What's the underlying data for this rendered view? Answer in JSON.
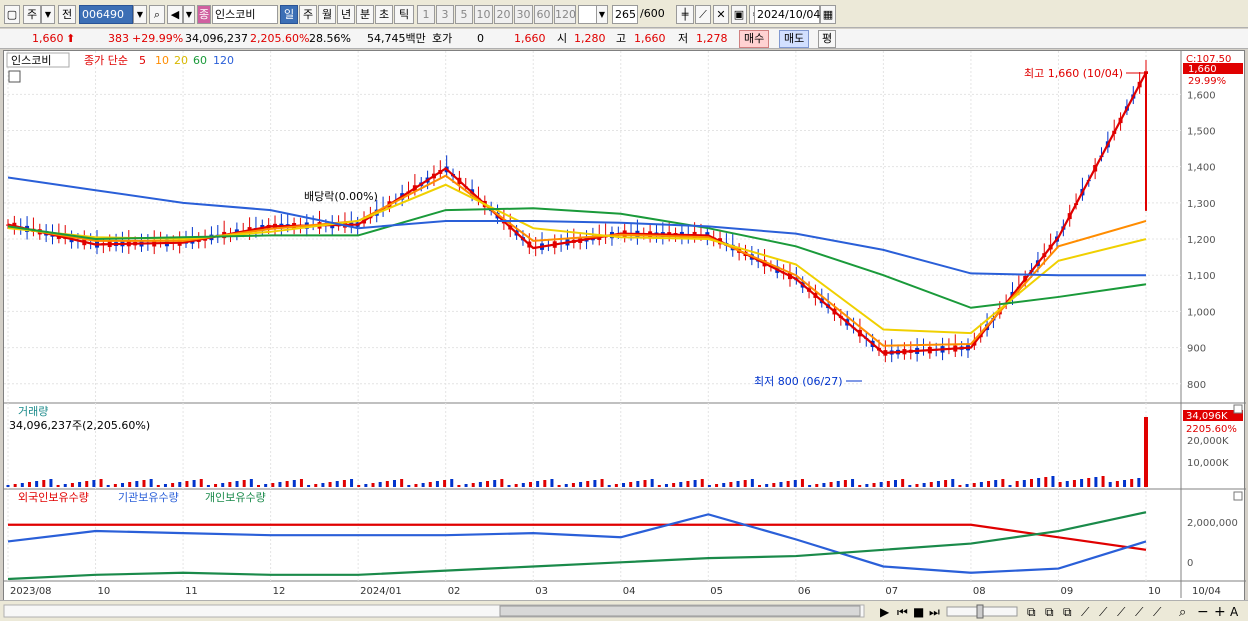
{
  "toolbar": {
    "market": "주",
    "prefix": "전",
    "code": "006490",
    "type_badge": "종",
    "stock_name": "인스코비",
    "periods": [
      "일",
      "주",
      "월",
      "년",
      "분",
      "초",
      "틱"
    ],
    "active_period": "일",
    "intervals": [
      "1",
      "3",
      "5",
      "10",
      "20",
      "30",
      "60",
      "120"
    ],
    "count": "265",
    "count_max": "/600",
    "date": "2024/10/04"
  },
  "quote": {
    "price": "1,660",
    "change": "383",
    "change_pct": "+29.99%",
    "volume": "34,096,237",
    "volume_pct": "2,205.60%",
    "turnover": "28.56%",
    "amount": "54,745백만",
    "ask_label": "호가",
    "ask_value": "0",
    "ask_price": "1,660",
    "open_label": "시",
    "open": "1,280",
    "high_label": "고",
    "high": "1,660",
    "low_label": "저",
    "low": "1,278",
    "buy_label": "매수",
    "sell_label": "매도",
    "eval_label": "평"
  },
  "price_panel": {
    "name": "인스코비",
    "ma_label": "종가 단순",
    "ma_periods": [
      "5",
      "10",
      "20",
      "60",
      "120"
    ],
    "ma_colors": [
      "#e00000",
      "#ff8c00",
      "#f0d000",
      "#1a9a3a",
      "#2a5fd8"
    ],
    "dividend_label": "배당락(0.00%)",
    "high_annotation": "최고 1,660 (10/04)",
    "low_annotation": "최저 800 (06/27)",
    "top_right_code": "C:107.50",
    "last_price_tag": "1,660",
    "last_pct_tag": "29.99%",
    "y_ticks": [
      "1,600",
      "1,500",
      "1,400",
      "1,300",
      "1,200",
      "1,100",
      "1,000",
      "900",
      "800"
    ]
  },
  "volume_panel": {
    "title": "거래량",
    "value_label": "34,096,237주(2,205.60%)",
    "tag_value": "34,096K",
    "tag_pct": "2205.60%",
    "y_ticks": [
      "20,000K",
      "10,000K"
    ]
  },
  "holdings_panel": {
    "labels": [
      "외국인보유수량",
      "기관보유수량",
      "개인보유수량"
    ],
    "colors": [
      "#e00000",
      "#2a5fd8",
      "#1a8a4a"
    ],
    "y_ticks": [
      "2,000,000",
      "0"
    ]
  },
  "x_axis": {
    "labels": [
      "2023/08",
      "10",
      "11",
      "12",
      "2024/01",
      "02",
      "03",
      "04",
      "05",
      "06",
      "07",
      "08",
      "09",
      "10",
      "10/04"
    ]
  },
  "chart_data": {
    "type": "line",
    "title": "",
    "x": [
      "2023/08",
      "10",
      "11",
      "12",
      "2024/01",
      "02",
      "03",
      "04",
      "05",
      "06",
      "07",
      "08",
      "09",
      "10"
    ],
    "series": [
      {
        "name": "5",
        "values": [
          1240,
          1185,
          1190,
          1235,
          1240,
          1395,
          1175,
          1215,
          1210,
          1090,
          885,
          900,
          1205,
          1660
        ]
      },
      {
        "name": "10",
        "values": [
          1235,
          1195,
          1195,
          1228,
          1250,
          1375,
          1195,
          1212,
          1205,
          1100,
          905,
          910,
          1180,
          1250
        ]
      },
      {
        "name": "20",
        "values": [
          1230,
          1205,
          1200,
          1220,
          1250,
          1350,
          1230,
          1205,
          1200,
          1130,
          950,
          940,
          1140,
          1200
        ]
      },
      {
        "name": "60",
        "values": [
          1235,
          1200,
          1205,
          1210,
          1210,
          1280,
          1285,
          1270,
          1230,
          1180,
          1100,
          1010,
          1040,
          1075
        ]
      },
      {
        "name": "120",
        "values": [
          1370,
          1335,
          1300,
          1280,
          1230,
          1250,
          1250,
          1245,
          1235,
          1215,
          1170,
          1105,
          1100,
          1100
        ]
      }
    ],
    "ylim": [
      780,
      1670
    ],
    "volume_axis": "20,000K / 10,000K",
    "annotations": [
      "최고 1,660 (10/04)",
      "최저 800 (06/27)",
      "배당락(0.00%)"
    ]
  },
  "bottom_icons": [
    "play-icon",
    "prev-icon",
    "stop-icon",
    "next-icon",
    "zoom-icon",
    "minus-icon",
    "plus-icon"
  ]
}
